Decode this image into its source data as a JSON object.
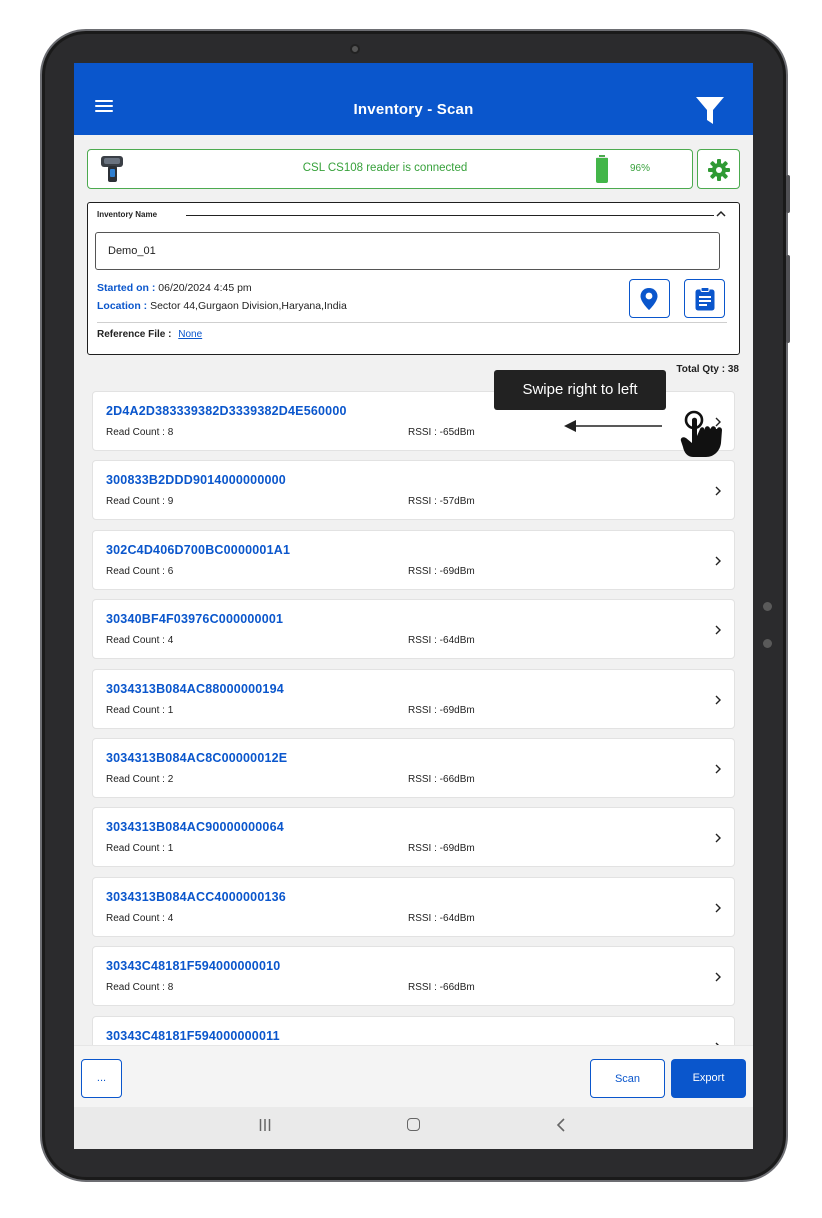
{
  "app_bar": {
    "title": "Inventory - Scan",
    "menu_icon": "hamburger-menu-icon",
    "filter_icon": "filter-funnel-icon",
    "color": "#0a56cc"
  },
  "reader": {
    "status_text": "CSL CS108 reader is connected",
    "battery_level": 0.96,
    "battery_text": "96%",
    "status_color": "#37a13b",
    "settings_icon": "gear-icon"
  },
  "inventory": {
    "name_label": "Inventory Name",
    "name_value": "Demo_01",
    "started_label": "Started on :",
    "started_value": "06/20/2024 4:45 pm",
    "location_label": "Location :",
    "location_value": "Sector 44,Gurgaon Division,Haryana,India",
    "reference_label": "Reference File :",
    "reference_value": "None"
  },
  "summary": {
    "total_qty_text": "Total Qty : 38"
  },
  "hint": {
    "text": "Swipe right to left"
  },
  "tags": [
    {
      "epc": "2D4A2D383339382D3339382D4E560000",
      "read_count": "Read Count : 8",
      "rssi": "RSSI : -65dBm"
    },
    {
      "epc": "300833B2DDD9014000000000",
      "read_count": "Read Count : 9",
      "rssi": "RSSI : -57dBm"
    },
    {
      "epc": "302C4D406D700BC0000001A1",
      "read_count": "Read Count : 6",
      "rssi": "RSSI : -69dBm"
    },
    {
      "epc": "30340BF4F03976C000000001",
      "read_count": "Read Count : 4",
      "rssi": "RSSI : -64dBm"
    },
    {
      "epc": "3034313B084AC88000000194",
      "read_count": "Read Count : 1",
      "rssi": "RSSI : -69dBm"
    },
    {
      "epc": "3034313B084AC8C00000012E",
      "read_count": "Read Count : 2",
      "rssi": "RSSI : -66dBm"
    },
    {
      "epc": "3034313B084AC90000000064",
      "read_count": "Read Count : 1",
      "rssi": "RSSI : -69dBm"
    },
    {
      "epc": "3034313B084ACC4000000136",
      "read_count": "Read Count : 4",
      "rssi": "RSSI : -64dBm"
    },
    {
      "epc": "30343C48181F594000000010",
      "read_count": "Read Count : 8",
      "rssi": "RSSI : -66dBm"
    },
    {
      "epc": "30343C48181F594000000011",
      "read_count": "",
      "rssi": ""
    }
  ],
  "actions": {
    "more_label": "...",
    "scan_label": "Scan",
    "export_label": "Export"
  }
}
